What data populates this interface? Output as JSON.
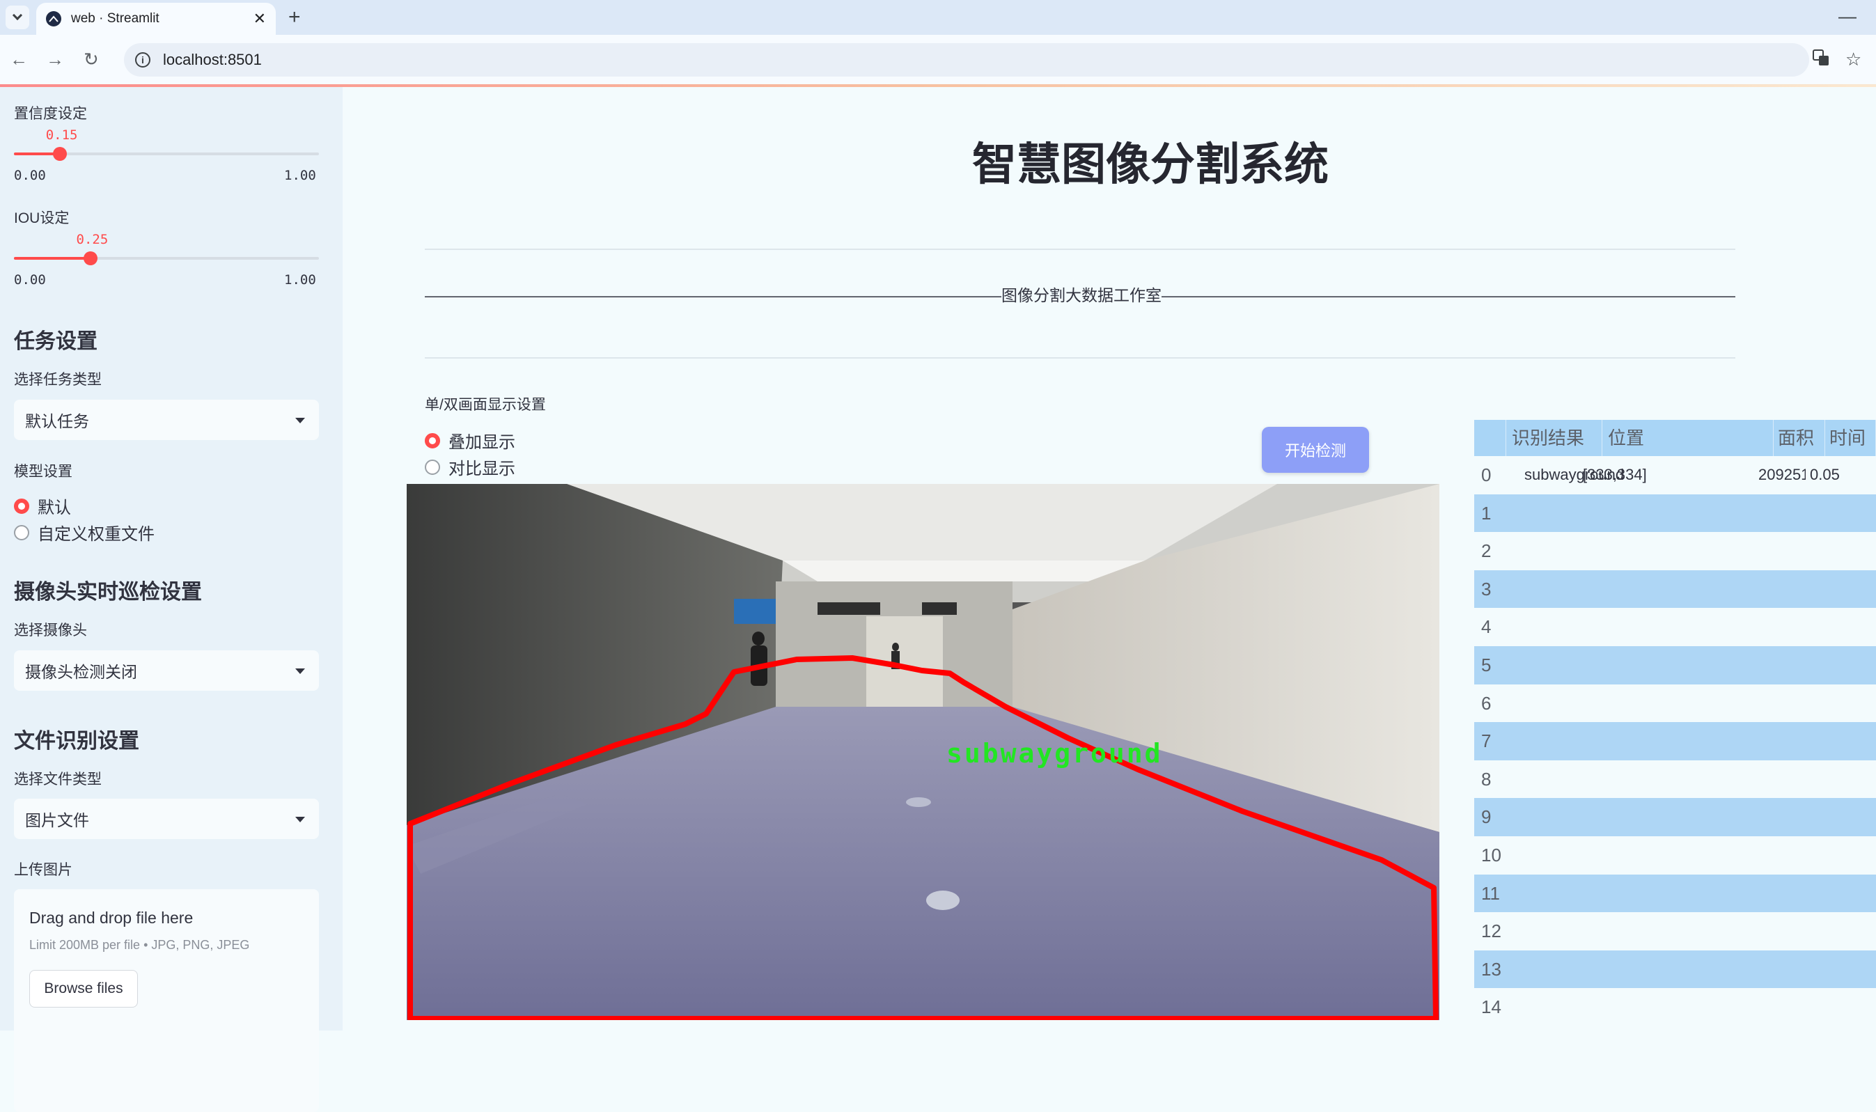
{
  "browser": {
    "tab_title": "web · Streamlit",
    "url": "localhost:8501"
  },
  "sidebar": {
    "confidence": {
      "label": "置信度设定",
      "value": "0.15",
      "value_num": 0.15,
      "min": "0.00",
      "max": "1.00"
    },
    "iou": {
      "label": "IOU设定",
      "value": "0.25",
      "value_num": 0.25,
      "min": "0.00",
      "max": "1.00"
    },
    "task": {
      "heading": "任务设置",
      "select_label": "选择任务类型",
      "selected": "默认任务"
    },
    "model": {
      "label": "模型设置",
      "options": [
        "默认",
        "自定义权重文件"
      ],
      "selected_index": 0
    },
    "camera": {
      "heading": "摄像头实时巡检设置",
      "select_label": "选择摄像头",
      "selected": "摄像头检测关闭"
    },
    "file": {
      "heading": "文件识别设置",
      "select_label": "选择文件类型",
      "selected": "图片文件"
    },
    "upload": {
      "label": "上传图片",
      "drop_text": "Drag and drop file here",
      "limit_text": "Limit 200MB per file • JPG, PNG, JPEG",
      "browse_label": "Browse files"
    }
  },
  "main": {
    "title": "智慧图像分割系统",
    "studio_text": "————————————————————————————————————图像分割大数据工作室————————————————————————————————————",
    "display_mode": {
      "label": "单/双画面显示设置",
      "options": [
        "叠加显示",
        "对比显示"
      ],
      "selected_index": 0
    },
    "start_button": "开始检测",
    "detection_label": "subwayground"
  },
  "results_table": {
    "columns": [
      "",
      "识别结果",
      "位置",
      "面积",
      "时间"
    ],
    "rows": [
      {
        "index": "0",
        "result": "subwayground",
        "position": "[333,334]",
        "area": "209251",
        "time": "0.05"
      },
      {
        "index": "1",
        "result": "",
        "position": "",
        "area": "",
        "time": ""
      },
      {
        "index": "2",
        "result": "",
        "position": "",
        "area": "",
        "time": ""
      },
      {
        "index": "3",
        "result": "",
        "position": "",
        "area": "",
        "time": ""
      },
      {
        "index": "4",
        "result": "",
        "position": "",
        "area": "",
        "time": ""
      },
      {
        "index": "5",
        "result": "",
        "position": "",
        "area": "",
        "time": ""
      },
      {
        "index": "6",
        "result": "",
        "position": "",
        "area": "",
        "time": ""
      },
      {
        "index": "7",
        "result": "",
        "position": "",
        "area": "",
        "time": ""
      },
      {
        "index": "8",
        "result": "",
        "position": "",
        "area": "",
        "time": ""
      },
      {
        "index": "9",
        "result": "",
        "position": "",
        "area": "",
        "time": ""
      },
      {
        "index": "10",
        "result": "",
        "position": "",
        "area": "",
        "time": ""
      },
      {
        "index": "11",
        "result": "",
        "position": "",
        "area": "",
        "time": ""
      },
      {
        "index": "12",
        "result": "",
        "position": "",
        "area": "",
        "time": ""
      },
      {
        "index": "13",
        "result": "",
        "position": "",
        "area": "",
        "time": ""
      },
      {
        "index": "14",
        "result": "",
        "position": "",
        "area": "",
        "time": ""
      }
    ]
  },
  "colors": {
    "accent": "#ff4b4b",
    "button": "#8d9ff7",
    "table_stripe": "#aed6f5",
    "mask_outline": "#ff0000",
    "label_text": "#22e622"
  }
}
